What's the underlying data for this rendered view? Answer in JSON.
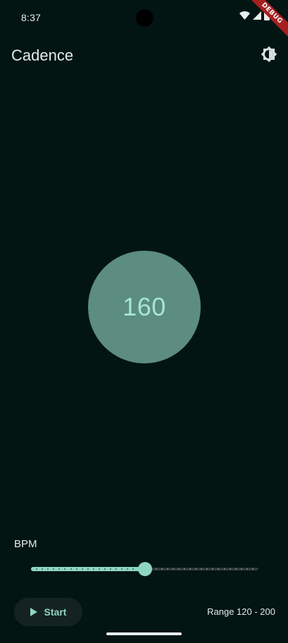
{
  "status_bar": {
    "time": "8:37",
    "icons": [
      "wifi-icon",
      "signal-icon",
      "battery-icon"
    ]
  },
  "debug_banner": {
    "label": "DEBUG",
    "color": "#a6201f"
  },
  "app_bar": {
    "title": "Cadence",
    "action_icon": "brightness-icon"
  },
  "metronome": {
    "bpm_value": "160",
    "circle_color": "#5c8d7e",
    "text_color": "#a5e6d4"
  },
  "controls": {
    "bpm_label": "BPM",
    "slider": {
      "min": 120,
      "max": 200,
      "value": 160,
      "divisions": 80,
      "active_color": "#8fd6bf"
    },
    "start_button": {
      "label": "Start",
      "icon": "play-icon"
    },
    "range_text": "Range 120 - 200"
  },
  "colors": {
    "background": "#021513",
    "accent": "#8fd6bf"
  }
}
